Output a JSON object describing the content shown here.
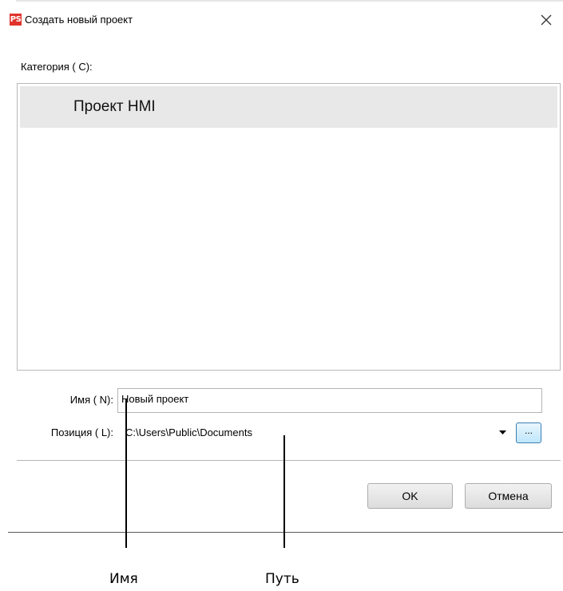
{
  "dialog": {
    "title": "Создать новый проект",
    "app_icon_text": "PS",
    "app_icon_color": "#e0332b"
  },
  "category": {
    "label": "Категория ( C):",
    "items": [
      {
        "label": "Проект HMI",
        "selected": true
      }
    ]
  },
  "name_field": {
    "label": "Имя ( N):",
    "value": "Новый проект"
  },
  "location_field": {
    "label": "Позиция ( L):",
    "value": "C:\\Users\\Public\\Documents",
    "browse_label": "..."
  },
  "buttons": {
    "ok": "OK",
    "cancel": "Отмена"
  },
  "annotations": {
    "name": "Имя",
    "path": "Путь"
  },
  "colors": {
    "selected_item_bg": "#e8e8e8",
    "browse_button_border": "#3c7fb1"
  }
}
